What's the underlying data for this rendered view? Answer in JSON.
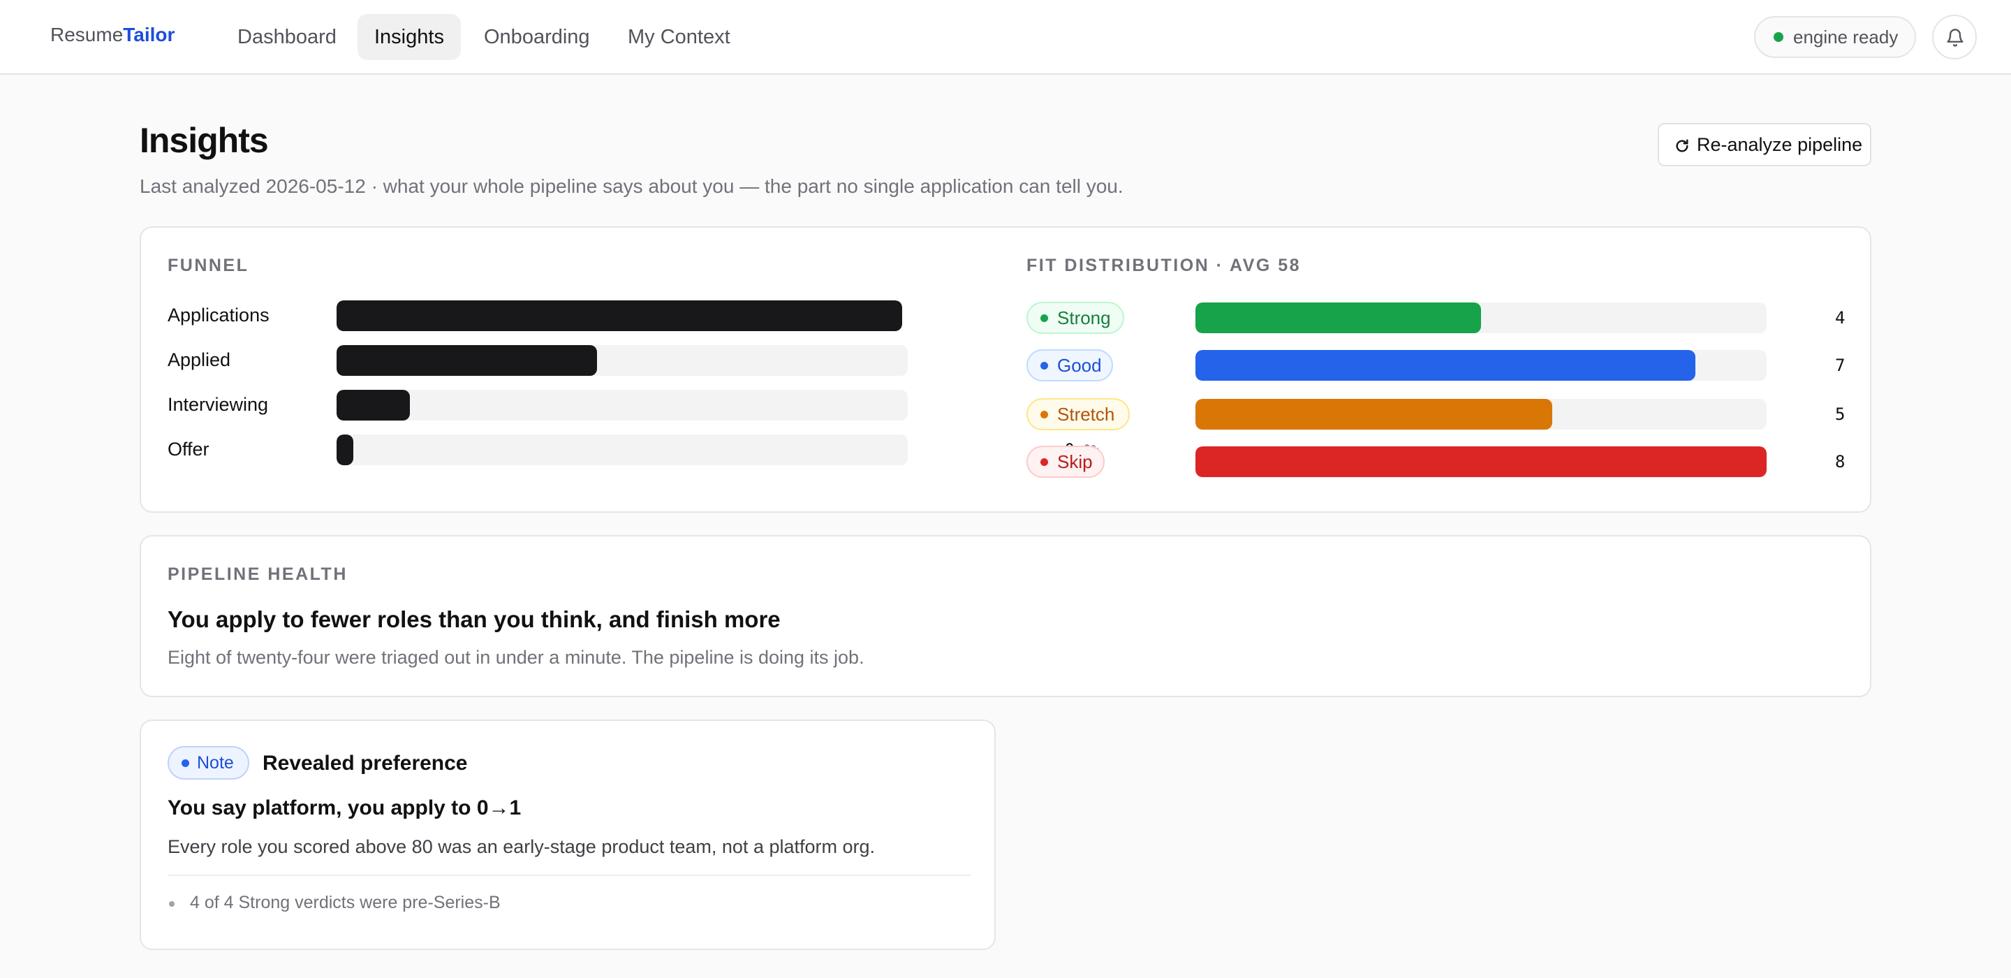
{
  "brand": {
    "part1": "Resume",
    "part2": "Tailor",
    "accent_color": "#1d4ed8"
  },
  "nav": {
    "tabs": [
      {
        "label": "Dashboard",
        "active": false
      },
      {
        "label": "Insights",
        "active": true
      },
      {
        "label": "Onboarding",
        "active": false
      },
      {
        "label": "My Context",
        "active": false
      }
    ]
  },
  "status": {
    "label": "engine ready",
    "color": "#16a34a"
  },
  "icons": {
    "bell": "bell-icon",
    "refresh": "refresh-icon"
  },
  "page": {
    "title": "Insights",
    "subtitle": "Last analyzed 2026-05-12 · what your whole pipeline says about you — the part no single application can tell you.",
    "reanalyze_label": "Re-analyze pipeline"
  },
  "funnel": {
    "label": "FUNNEL",
    "rows": [
      {
        "label": "Applications",
        "count": "24",
        "pct": "100%",
        "fraction": 1.0
      },
      {
        "label": "Applied",
        "count": "11",
        "pct": "46%",
        "fraction": 0.46
      },
      {
        "label": "Interviewing",
        "count": "3",
        "pct": "13%",
        "fraction": 0.13
      },
      {
        "label": "Offer",
        "count": "0",
        "pct": "0%",
        "fraction": 0.0
      }
    ],
    "bar_color": "#18181b"
  },
  "fit": {
    "label": "FIT DISTRIBUTION · AVG 58",
    "max": 8,
    "rows": [
      {
        "label": "Strong",
        "count": 4,
        "color": "#16a34a",
        "text": "#15803d",
        "bg": "#f0fdf4",
        "border": "#bbf7d0"
      },
      {
        "label": "Good",
        "count": 7,
        "color": "#2563eb",
        "text": "#1d4ed8",
        "bg": "#eff6ff",
        "border": "#bfdbfe"
      },
      {
        "label": "Stretch",
        "count": 5,
        "color": "#d97706",
        "text": "#b45309",
        "bg": "#fffbeb",
        "border": "#fde68a"
      },
      {
        "label": "Skip",
        "count": 8,
        "color": "#dc2626",
        "text": "#b91c1c",
        "bg": "#fef2f2",
        "border": "#fecaca"
      }
    ]
  },
  "health": {
    "label": "PIPELINE HEALTH",
    "title": "You apply to fewer roles than you think, and finish more",
    "text": "Eight of twenty-four were triaged out in under a minute. The pipeline is doing its job."
  },
  "note": {
    "badge": "Note",
    "heading": "Revealed preference",
    "title": "You say platform, you apply to 0→1",
    "text": "Every role you scored above 80 was an early-stage product team, not a platform org.",
    "bullets": [
      "4 of 4 Strong verdicts were pre-Series-B"
    ]
  }
}
